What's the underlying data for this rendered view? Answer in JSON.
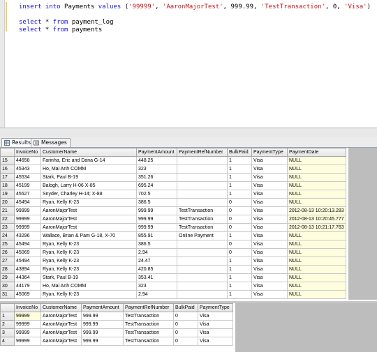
{
  "editor": {
    "line1": {
      "kw1": "insert into",
      "name": " Payments ",
      "kw2": "values",
      "open": " (",
      "s1": "'99999'",
      "c1": ", ",
      "s2": "'AaronMajorTest'",
      "c2": ", ",
      "n1": "999.99",
      "c3": ", ",
      "s3": "'TestTransaction'",
      "c4": ", ",
      "n2": "0",
      "c5": ", ",
      "s4": "'Visa'",
      "close": ")"
    },
    "line2": {
      "kw1": "select",
      "star": " * ",
      "kw2": "from",
      "name": " payment_log"
    },
    "line3": {
      "kw1": "select",
      "star": " * ",
      "kw2": "from",
      "name": " payments"
    }
  },
  "tabs": {
    "results": "Results",
    "messages": "Messages"
  },
  "grid1": {
    "columns": [
      "",
      "InvoiceNo",
      "CustomerName",
      "PaymentAmount",
      "PaymentRefNumber",
      "BulkPaid",
      "PaymentType",
      "PaymentDate"
    ],
    "rows": [
      [
        "15",
        "44658",
        "Farinha, Eric and Dana G-14",
        "448.25",
        "",
        "1",
        "Visa",
        "NULL"
      ],
      [
        "16",
        "45343",
        "Ho, Mai Anh  COMM",
        "323",
        "",
        "1",
        "Visa",
        "NULL"
      ],
      [
        "17",
        "45534",
        "Stark, Paul B-19",
        "351.26",
        "",
        "1",
        "Visa",
        "NULL"
      ],
      [
        "18",
        "45199",
        "Balogh, Larry H-06  X-85",
        "695.24",
        "",
        "1",
        "Visa",
        "NULL"
      ],
      [
        "19",
        "45527",
        "Snyder, Charley H-14; X-88",
        "702.5",
        "",
        "1",
        "Visa",
        "NULL"
      ],
      [
        "20",
        "45494",
        "Ryan, Kelly K-23",
        "386.5",
        "",
        "0",
        "Visa",
        "NULL"
      ],
      [
        "21",
        "99999",
        "AaronMajorTest",
        "999.99",
        "TestTransaction",
        "0",
        "Visa",
        "2012-08-13 10:20:13.283"
      ],
      [
        "22",
        "99999",
        "AaronMajorTest",
        "999.99",
        "TestTransaction",
        "0",
        "Visa",
        "2012-08-13 10:20:45.777"
      ],
      [
        "23",
        "99999",
        "AaronMajorTest",
        "999.99",
        "TestTransaction",
        "0",
        "Visa",
        "2012-08-13 10:21:17.763"
      ],
      [
        "24",
        "43296",
        "Wallace, Brian & Pam  G-18, X-70",
        "855.91",
        "Online Payment",
        "1",
        "Visa",
        "NULL"
      ],
      [
        "25",
        "45494",
        "Ryan, Kelly K-23",
        "386.5",
        "",
        "0",
        "Visa",
        "NULL"
      ],
      [
        "26",
        "45069",
        "Ryan, Kelly K-23",
        "2.94",
        "",
        "0",
        "Visa",
        "NULL"
      ],
      [
        "27",
        "45494",
        "Ryan, Kelly K-23",
        "24.47",
        "",
        "1",
        "Visa",
        "NULL"
      ],
      [
        "28",
        "43894",
        "Ryan, Kelly K-23",
        "420.85",
        "",
        "1",
        "Visa",
        "NULL"
      ],
      [
        "29",
        "44364",
        "Stark, Paul B-19",
        "353.41",
        "",
        "1",
        "Visa",
        "NULL"
      ],
      [
        "30",
        "44179",
        "Ho, Mai Anh  COMM",
        "323",
        "",
        "1",
        "Visa",
        "NULL"
      ],
      [
        "31",
        "45069",
        "Ryan, Kelly K-23",
        "2.94",
        "",
        "1",
        "Visa",
        "NULL"
      ]
    ]
  },
  "grid2": {
    "columns": [
      "",
      "InvoiceNo",
      "CustomerName",
      "PaymentAmount",
      "PaymentRefNumber",
      "BulkPaid",
      "PaymentType"
    ],
    "rows": [
      [
        "1",
        "99999",
        "AaronMajorTest",
        "999.99",
        "TestTransaction",
        "0",
        "Visa"
      ],
      [
        "2",
        "99999",
        "AaronMajorTest",
        "999.99",
        "TestTransaction",
        "0",
        "Visa"
      ],
      [
        "3",
        "99999",
        "AaronMajorTest",
        "999.99",
        "TestTransaction",
        "0",
        "Visa"
      ],
      [
        "4",
        "99999",
        "AaronMajorTest",
        "999.99",
        "TestTransaction",
        "0",
        "Visa"
      ]
    ]
  }
}
